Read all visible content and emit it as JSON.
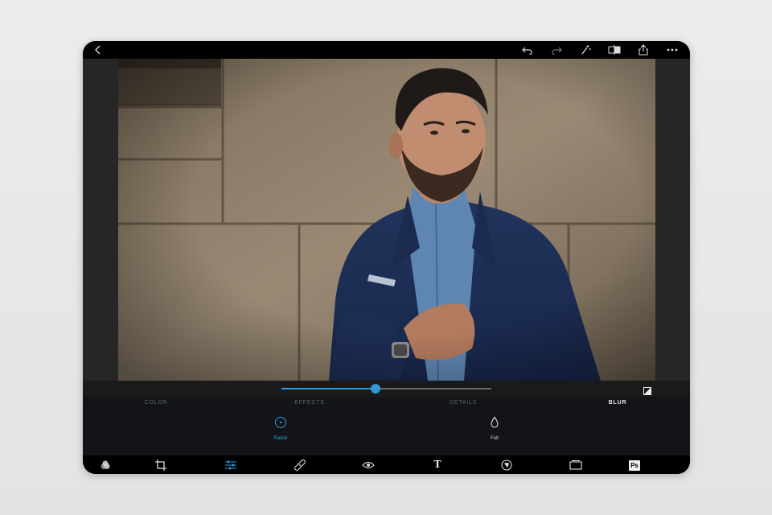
{
  "colors": {
    "accent": "#2e9bd6",
    "panel": "#121418",
    "inactive_tab": "#5c6470"
  },
  "topbar": {
    "left_icon": "back-chevron-icon",
    "right_icons": [
      "undo-icon",
      "redo-icon",
      "magic-wand-icon",
      "compare-split-icon",
      "share-icon",
      "more-icon"
    ]
  },
  "slider": {
    "value_fraction": 0.45
  },
  "tabs": [
    {
      "label": "COLOR",
      "active": false
    },
    {
      "label": "EFFECTS",
      "active": false
    },
    {
      "label": "DETAILS",
      "active": false
    },
    {
      "label": "BLUR",
      "active": true
    }
  ],
  "blur_options": [
    {
      "label": "Radial",
      "icon": "radial-blur-icon",
      "selected": true
    },
    {
      "label": "Full",
      "icon": "full-blur-drop-icon",
      "selected": false
    }
  ],
  "bottom_tools": [
    "looks-icon",
    "crop-icon",
    "adjustments-icon",
    "healing-bandage-icon",
    "red-eye-icon",
    "text-icon",
    "stickers-icon",
    "borders-icon",
    "photoshop-icon"
  ],
  "bottom_text_label": "T",
  "ps_label": "Ps"
}
